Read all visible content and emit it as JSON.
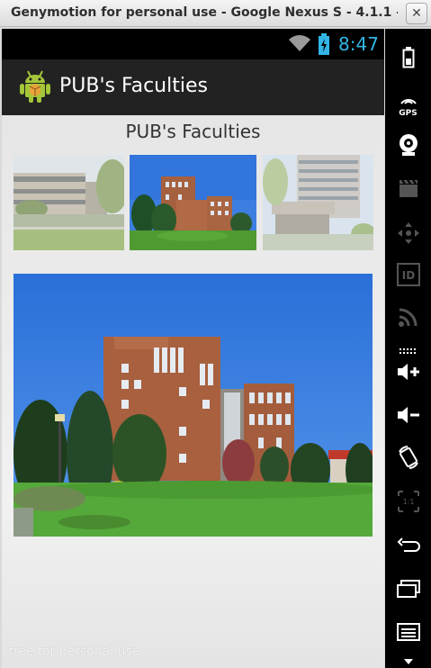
{
  "window": {
    "title": "Genymotion for personal use - Google Nexus S - 4.1.1 - A...",
    "close_glyph": "✕"
  },
  "status_bar": {
    "time": "8:47",
    "icons": [
      "wifi-icon",
      "battery-charging-icon"
    ],
    "accent": "#33b5e5"
  },
  "action_bar": {
    "title": "PUB's Faculties",
    "icon": "android-app-icon"
  },
  "main": {
    "heading": "PUB's Faculties",
    "thumbnails": [
      "faculty-photo-1",
      "faculty-photo-2",
      "faculty-photo-3"
    ],
    "selected_photo": "faculty-photo-2"
  },
  "watermark": "free for personal use",
  "toolbar": {
    "items": [
      {
        "name": "battery-tool-icon",
        "label": ""
      },
      {
        "name": "gps-icon",
        "label": "GPS"
      },
      {
        "name": "camera-icon",
        "label": ""
      },
      {
        "name": "capture-icon",
        "label": ""
      },
      {
        "name": "dpad-icon",
        "label": ""
      },
      {
        "name": "id-icon",
        "label": "ID"
      },
      {
        "name": "rss-icon",
        "label": ""
      },
      {
        "name": "volume-up-icon",
        "label": ""
      },
      {
        "name": "volume-down-icon",
        "label": ""
      },
      {
        "name": "rotate-icon",
        "label": ""
      },
      {
        "name": "scale-icon",
        "label": "1:1"
      },
      {
        "name": "back-icon",
        "label": ""
      },
      {
        "name": "recent-apps-icon",
        "label": ""
      },
      {
        "name": "menu-icon",
        "label": ""
      }
    ]
  }
}
